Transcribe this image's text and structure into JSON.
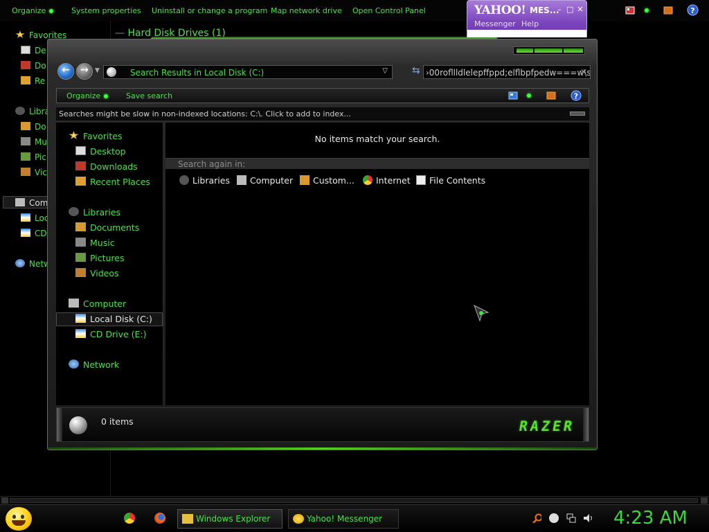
{
  "background_window": {
    "toolbar": {
      "organize": "Organize",
      "system_properties": "System properties",
      "uninstall": "Uninstall or change a program",
      "map_drive": "Map network drive",
      "control_panel": "Open Control Panel"
    },
    "group_header": "Hard Disk Drives (1)",
    "nav": {
      "favorites": "Favorites",
      "fav_1": "De",
      "fav_2": "Do",
      "fav_3": "Re",
      "libraries": "Libra",
      "lib_1": "Do",
      "lib_2": "Mu",
      "lib_3": "Pic",
      "lib_4": "Vic",
      "computer": "Com",
      "drive_1": "Loc",
      "drive_2": "CD",
      "network": "Netw"
    }
  },
  "yahoo": {
    "logo": "YAHOO!",
    "title": "MES...",
    "menu_messenger": "Messenger",
    "menu_help": "Help"
  },
  "explorer": {
    "address": "Search Results in Local Disk (C:)",
    "search_query": "›00rofllldlelepffppd;elflbpfpedw===w\\s",
    "commands": {
      "organize": "Organize",
      "save_search": "Save search"
    },
    "infobar": "Searches might be slow in non-indexed locations: C:\\. Click to add to index...",
    "nav": {
      "favorites": "Favorites",
      "desktop": "Desktop",
      "downloads": "Downloads",
      "recent_places": "Recent Places",
      "libraries": "Libraries",
      "documents": "Documents",
      "music": "Music",
      "pictures": "Pictures",
      "videos": "Videos",
      "computer": "Computer",
      "local_disk": "Local Disk (C:)",
      "cd_drive": "CD Drive (E:)",
      "network": "Network"
    },
    "content": {
      "no_items": "No items match your search.",
      "search_again": "Search again in:",
      "options": {
        "libraries": "Libraries",
        "computer": "Computer",
        "custom": "Custom...",
        "internet": "Internet",
        "file_contents": "File Contents"
      }
    },
    "status": {
      "count": "0 items",
      "brand": "RAZER"
    }
  },
  "taskbar": {
    "windows_explorer": "Windows Explorer",
    "yahoo_messenger": "Yahoo! Messenger",
    "clock": "4:23 AM"
  },
  "colors": {
    "accent_green": "#4ce04c",
    "yahoo_purple": "#7b45bd",
    "razer_green": "#5ae030"
  }
}
